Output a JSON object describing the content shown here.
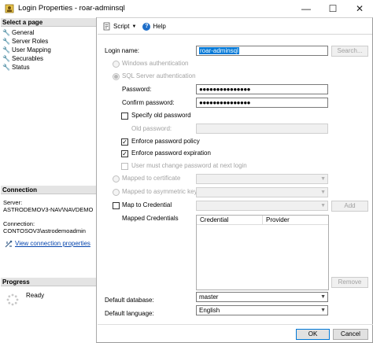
{
  "window": {
    "title": "Login Properties - roar-adminsql",
    "minimize_glyph": "—",
    "maximize_glyph": "☐",
    "close_glyph": "✕"
  },
  "left": {
    "select_page_header": "Select a page",
    "pages": [
      "General",
      "Server Roles",
      "User Mapping",
      "Securables",
      "Status"
    ],
    "connection_header": "Connection",
    "server_label": "Server:",
    "server_value": "ASTRODEMOV3-NAV\\NAVDEMO",
    "connection_label": "Connection:",
    "connection_value": "CONTOSOV3\\astrodemoadmin",
    "view_conn_link": "View connection properties",
    "progress_header": "Progress",
    "progress_status": "Ready"
  },
  "toolbar": {
    "script_label": "Script",
    "help_label": "Help"
  },
  "form": {
    "login_name_label": "Login name:",
    "login_name_value": "roar-adminsql",
    "search_button": "Search...",
    "windows_auth": "Windows authentication",
    "sql_auth": "SQL Server authentication",
    "password_label": "Password:",
    "password_value": "●●●●●●●●●●●●●●●",
    "confirm_label": "Confirm password:",
    "confirm_value": "●●●●●●●●●●●●●●●",
    "specify_old": "Specify old password",
    "old_password_label": "Old password:",
    "enforce_policy": "Enforce password policy",
    "enforce_expiration": "Enforce password expiration",
    "must_change": "User must change password at next login",
    "mapped_cert": "Mapped to certificate",
    "mapped_asym": "Mapped to asymmetric key",
    "map_credential": "Map to Credential",
    "add_button": "Add",
    "mapped_credentials_label": "Mapped Credentials",
    "grid_columns": [
      "Credential",
      "Provider"
    ],
    "remove_button": "Remove",
    "default_db_label": "Default database:",
    "default_db_value": "master",
    "default_lang_label": "Default language:",
    "default_lang_value": "English"
  },
  "footer": {
    "ok": "OK",
    "cancel": "Cancel"
  },
  "icons": {
    "check": "✓",
    "dropdown": "▼"
  }
}
